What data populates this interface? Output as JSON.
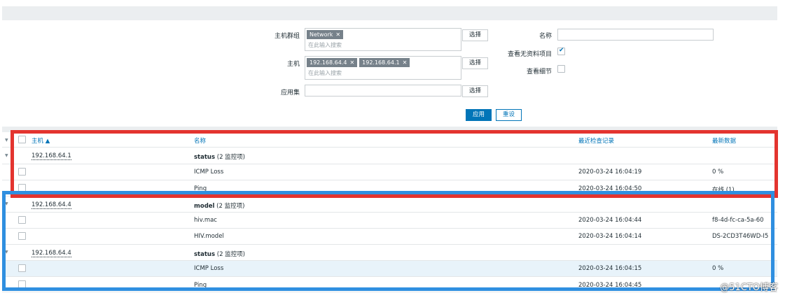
{
  "filter": {
    "host_groups": {
      "label": "主机群组",
      "tags": [
        "Network"
      ],
      "placeholder": "在此输入搜索",
      "select_label": "选择"
    },
    "hosts": {
      "label": "主机",
      "tags": [
        "192.168.64.4",
        "192.168.64.1"
      ],
      "placeholder": "在此输入搜索",
      "select_label": "选择"
    },
    "application": {
      "label": "应用集",
      "value": "",
      "select_label": "选择"
    },
    "name": {
      "label": "名称",
      "value": ""
    },
    "show_without_data": {
      "label": "查看无资料项目",
      "checked": true
    },
    "show_details": {
      "label": "查看细节",
      "checked": false
    },
    "apply_label": "应用",
    "reset_label": "重设"
  },
  "table": {
    "headers": {
      "host": "主机 ▲",
      "name": "名称",
      "last_check": "最近检查记录",
      "last_value": "最新数据"
    },
    "groups": [
      {
        "host": "192.168.64.1",
        "app": "status",
        "count": "(2 监控项)",
        "items": [
          {
            "name": "ICMP Loss",
            "last_check": "2020-03-24 16:04:19",
            "last_value": "0 %"
          },
          {
            "name": "Ping",
            "last_check": "2020-03-24 16:04:50",
            "last_value": "在线 (1)"
          }
        ]
      },
      {
        "host": "192.168.64.4",
        "app": "model",
        "count": "(2 监控项)",
        "items": [
          {
            "name": "hiv.mac",
            "last_check": "2020-03-24 16:04:44",
            "last_value": "f8-4d-fc-ca-5a-60"
          },
          {
            "name": "HIV.model",
            "last_check": "2020-03-24 16:04:14",
            "last_value": "DS-2CD3T46WD-I5"
          }
        ]
      },
      {
        "host": "192.168.64.4",
        "app": "status",
        "count": "(2 监控项)",
        "items": [
          {
            "name": "ICMP Loss",
            "last_check": "2020-03-24 16:04:15",
            "last_value": "0 %"
          },
          {
            "name": "Ping",
            "last_check": "2020-03-24 16:04:45",
            "last_value": ""
          }
        ]
      }
    ]
  },
  "watermark": "@51CTO博客",
  "colors": {
    "accent": "#0275b8",
    "red_box": "#e3342f",
    "blue_box": "#2f8fe0"
  }
}
